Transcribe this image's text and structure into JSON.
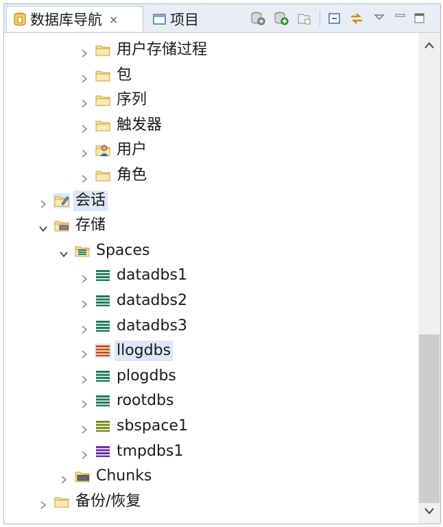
{
  "tabs": [
    {
      "label": "数据库导航",
      "active": true,
      "icon": "database-navigator-icon",
      "close": "×"
    },
    {
      "label": "项目",
      "active": false,
      "icon": "project-window-icon"
    }
  ],
  "toolbar": {
    "icons": [
      "database-settings-icon",
      "add-connection-icon",
      "new-folder-icon",
      "collapse-all-icon",
      "link-with-editor-icon",
      "view-menu-icon",
      "minimize-icon",
      "maximize-icon"
    ]
  },
  "tree": [
    {
      "label": "用户存储过程",
      "icon": "folder-icon",
      "level": 2,
      "expanded": false
    },
    {
      "label": "包",
      "icon": "folder-icon",
      "level": 2,
      "expanded": false
    },
    {
      "label": "序列",
      "icon": "folder-icon",
      "level": 2,
      "expanded": false
    },
    {
      "label": "触发器",
      "icon": "folder-icon",
      "level": 2,
      "expanded": false
    },
    {
      "label": "用户",
      "icon": "user-folder-icon",
      "level": 2,
      "expanded": false
    },
    {
      "label": "角色",
      "icon": "folder-icon",
      "level": 2,
      "expanded": false
    },
    {
      "label": "会话",
      "icon": "session-folder-icon",
      "level": 0,
      "expanded": false,
      "selected": true
    },
    {
      "label": "存储",
      "icon": "storage-folder-icon",
      "level": 0,
      "expanded": true
    },
    {
      "label": "Spaces",
      "icon": "spaces-folder-icon",
      "level": 1,
      "expanded": true
    },
    {
      "label": "datadbs1",
      "icon": "dbspace-icon",
      "level": 2,
      "expanded": false,
      "color": "#1f7a5a"
    },
    {
      "label": "datadbs2",
      "icon": "dbspace-icon",
      "level": 2,
      "expanded": false,
      "color": "#1f7a5a"
    },
    {
      "label": "datadbs3",
      "icon": "dbspace-icon",
      "level": 2,
      "expanded": false,
      "color": "#1f7a5a"
    },
    {
      "label": "llogdbs",
      "icon": "dbspace-icon",
      "level": 2,
      "expanded": false,
      "color": "#c0521f",
      "selected": true
    },
    {
      "label": "plogdbs",
      "icon": "dbspace-icon",
      "level": 2,
      "expanded": false,
      "color": "#1f7a5a"
    },
    {
      "label": "rootdbs",
      "icon": "dbspace-icon",
      "level": 2,
      "expanded": false,
      "color": "#1f7a5a"
    },
    {
      "label": "sbspace1",
      "icon": "dbspace-icon",
      "level": 2,
      "expanded": false,
      "color": "#7a8a1f"
    },
    {
      "label": "tmpdbs1",
      "icon": "dbspace-icon",
      "level": 2,
      "expanded": false,
      "color": "#6a2fa8"
    },
    {
      "label": "Chunks",
      "icon": "chunks-folder-icon",
      "level": 1,
      "expanded": false
    },
    {
      "label": "备份/恢复",
      "icon": "folder-icon",
      "level": 0,
      "expanded": false
    }
  ]
}
